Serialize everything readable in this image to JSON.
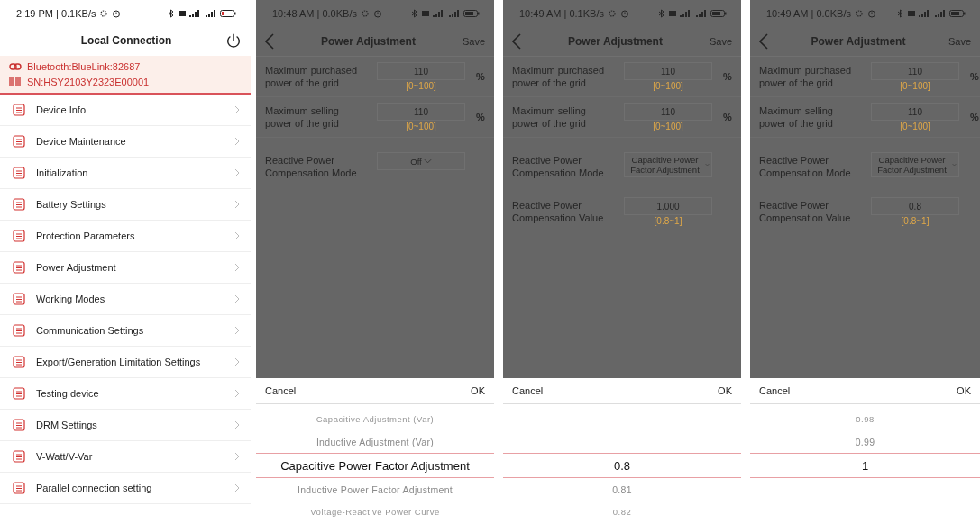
{
  "screens": [
    {
      "kind": "menu",
      "status_bar": {
        "time": "2:19 PM | 0.1KB/s"
      },
      "title": "Local Connection",
      "connection": {
        "bluetooth": "Bluetooth:BlueLink:82687",
        "serial": "SN:HSY2103Y2323E00001"
      },
      "menu_items": [
        {
          "label": "Device Info"
        },
        {
          "label": "Device Maintenance"
        },
        {
          "label": "Initialization"
        },
        {
          "label": "Battery Settings"
        },
        {
          "label": "Protection Parameters"
        },
        {
          "label": "Power Adjustment"
        },
        {
          "label": "Working Modes"
        },
        {
          "label": "Communication Settings"
        },
        {
          "label": "Export/Generation Limitation Settings"
        },
        {
          "label": "Testing device"
        },
        {
          "label": "DRM Settings"
        },
        {
          "label": "V-Watt/V-Var"
        },
        {
          "label": "Parallel connection setting"
        }
      ]
    },
    {
      "kind": "settings",
      "status_bar": {
        "time": "10:48 AM | 0.0KB/s"
      },
      "title": "Power Adjustment",
      "save": "Save",
      "fields": [
        {
          "kind": "input",
          "label": "Maximum purchased power of the grid",
          "value": "110",
          "range": "[0~100]",
          "unit": "%"
        },
        {
          "kind": "input",
          "label": "Maximum selling power of the grid",
          "value": "110",
          "range": "[0~100]",
          "unit": "%"
        },
        {
          "kind": "select",
          "label": "Reactive Power Compensation Mode",
          "value": "Off"
        }
      ],
      "picker": {
        "cancel": "Cancel",
        "ok": "OK",
        "options": [
          {
            "label": "Capacitive Adjustment (Var)",
            "selected": false
          },
          {
            "label": "Inductive Adjustment (Var)",
            "selected": false
          },
          {
            "label": "Capacitive Power Factor Adjustment",
            "selected": true
          },
          {
            "label": "Inductive Power Factor Adjustment",
            "selected": false
          },
          {
            "label": "Voltage-Reactive Power Curve",
            "selected": false
          }
        ]
      }
    },
    {
      "kind": "settings",
      "status_bar": {
        "time": "10:49 AM | 0.1KB/s"
      },
      "title": "Power Adjustment",
      "save": "Save",
      "fields": [
        {
          "kind": "input",
          "label": "Maximum purchased power of the grid",
          "value": "110",
          "range": "[0~100]",
          "unit": "%"
        },
        {
          "kind": "input",
          "label": "Maximum selling power of the grid",
          "value": "110",
          "range": "[0~100]",
          "unit": "%"
        },
        {
          "kind": "select",
          "label": "Reactive Power Compensation Mode",
          "value": "Capacitive Power Factor Adjustment"
        },
        {
          "kind": "input",
          "label": "Reactive Power Compensation Value",
          "value": "1.000",
          "range": "[0.8~1]"
        }
      ],
      "picker": {
        "cancel": "Cancel",
        "ok": "OK",
        "options": [
          {
            "label": "0.8",
            "selected": true
          },
          {
            "label": "0.81",
            "selected": false
          },
          {
            "label": "0.82",
            "selected": false
          }
        ]
      }
    },
    {
      "kind": "settings",
      "status_bar": {
        "time": "10:49 AM | 0.0KB/s"
      },
      "title": "Power Adjustment",
      "save": "Save",
      "fields": [
        {
          "kind": "input",
          "label": "Maximum purchased power of the grid",
          "value": "110",
          "range": "[0~100]",
          "unit": "%"
        },
        {
          "kind": "input",
          "label": "Maximum selling power of the grid",
          "value": "110",
          "range": "[0~100]",
          "unit": "%"
        },
        {
          "kind": "select",
          "label": "Reactive Power Compensation Mode",
          "value": "Capacitive Power Factor Adjustment"
        },
        {
          "kind": "input",
          "label": "Reactive Power Compensation Value",
          "value": "0.8",
          "range": "[0.8~1]"
        }
      ],
      "picker": {
        "cancel": "Cancel",
        "ok": "OK",
        "options": [
          {
            "label": "0.98",
            "selected": false
          },
          {
            "label": "0.99",
            "selected": false
          },
          {
            "label": "1",
            "selected": true
          }
        ]
      }
    }
  ]
}
